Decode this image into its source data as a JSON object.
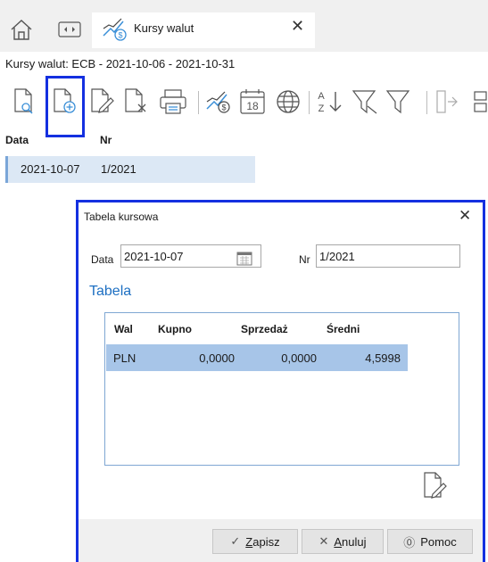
{
  "window": {
    "tab_title": "Kursy walut",
    "caption": "Kursy walut: ECB  - 2021-10-06 - 2021-10-31"
  },
  "toolbar": {
    "icons": [
      "preview-icon",
      "add-document-icon",
      "edit-document-icon",
      "delete-document-icon",
      "print-icon",
      "exchange-rate-icon",
      "calendar-icon",
      "globe-icon",
      "sort-az-icon",
      "filter-clear-icon",
      "filter-icon",
      "export-icon",
      "more-icon"
    ],
    "calendar_day": "18",
    "accent_color": "#1430e0"
  },
  "grid": {
    "columns": [
      "Data",
      "Nr"
    ],
    "rows": [
      {
        "date": "2021-10-07",
        "nr": "1/2021"
      }
    ]
  },
  "dialog": {
    "title": "Tabela kursowa",
    "date_label": "Data",
    "date_value": "2021-10-07",
    "nr_label": "Nr",
    "nr_value": "1/2021",
    "section_title": "Tabela",
    "table_columns": [
      "Wal",
      "Kupno",
      "Sprzedaż",
      "Średni"
    ],
    "table_rows": [
      {
        "wal": "PLN",
        "kupno": "0,0000",
        "sprzedaz": "0,0000",
        "sredni": "4,5998"
      }
    ],
    "buttons": {
      "save_prefix": "Z",
      "save_rest": "apisz",
      "cancel_prefix": "A",
      "cancel_rest": "nuluj",
      "help": "Pomoc"
    }
  }
}
